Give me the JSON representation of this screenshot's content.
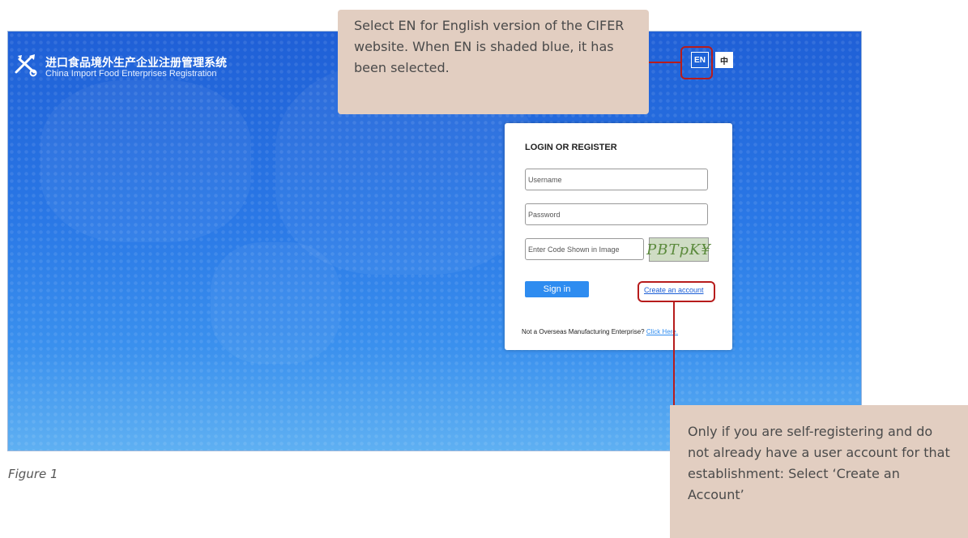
{
  "header": {
    "title_cn": "进口食品境外生产企业注册管理系统",
    "title_en": "China Import Food Enterprises Registration",
    "lang_en": "EN",
    "lang_cn": "中"
  },
  "login": {
    "title": "LOGIN OR REGISTER",
    "username_placeholder": "Username",
    "password_placeholder": "Password",
    "code_placeholder": "Enter Code Shown in Image",
    "captcha_text": "PBTpK¥",
    "sign_in": "Sign in",
    "create_account": "Create an account",
    "footer_text": "Not a Overseas Manufacturing Enterprise? ",
    "footer_link": "Click Here."
  },
  "annotations": {
    "top": "Select EN for English version of the CIFER website. When EN is shaded blue, it has been selected.",
    "bottom": "Only if you are self-registering and do not already have a user account for that establishment: Select ‘Create an Account’"
  },
  "caption": "Figure 1",
  "colors": {
    "highlight": "#b71c1c",
    "callout_bg": "#e2cec1",
    "button_blue": "#2e8cf0"
  }
}
